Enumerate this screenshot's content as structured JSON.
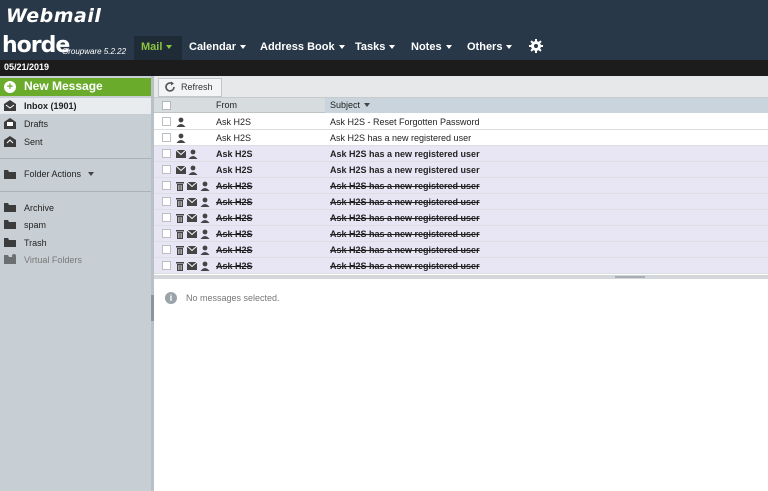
{
  "app": {
    "brand": "Webmail",
    "logo_word": "horde",
    "logo_sub": "Groupware 5.2.22",
    "date": "05/21/2019"
  },
  "menu": [
    {
      "label": "Mail",
      "active": true
    },
    {
      "label": "Calendar"
    },
    {
      "label": "Address Book"
    },
    {
      "label": "Tasks"
    },
    {
      "label": "Notes"
    },
    {
      "label": "Others"
    }
  ],
  "sidebar": {
    "new_message": "New Message",
    "folders": [
      {
        "label": "Inbox (1901)",
        "icon": "inbox-icon"
      },
      {
        "label": "Drafts",
        "icon": "drafts-icon"
      },
      {
        "label": "Sent",
        "icon": "sent-icon"
      }
    ],
    "folder_actions": "Folder Actions",
    "extra_folders": [
      {
        "label": "Archive",
        "icon": "folder-icon"
      },
      {
        "label": "spam",
        "icon": "folder-icon"
      },
      {
        "label": "Trash",
        "icon": "folder-icon"
      },
      {
        "label": "Virtual Folders",
        "icon": "virtual-folder-icon"
      }
    ]
  },
  "toolbar": {
    "refresh": "Refresh"
  },
  "list": {
    "columns": {
      "from": "From",
      "subject": "Subject"
    },
    "rows": [
      {
        "from": "Ask H2S",
        "subject": "Ask H2S - Reset Forgotten Password",
        "state": "read"
      },
      {
        "from": "Ask H2S",
        "subject": "Ask H2S has a new registered user",
        "state": "read"
      },
      {
        "from": "Ask H2S",
        "subject": "Ask H2S has a new registered user",
        "state": "unread"
      },
      {
        "from": "Ask H2S",
        "subject": "Ask H2S has a new registered user",
        "state": "unread"
      },
      {
        "from": "Ask H2S",
        "subject": "Ask H2S has a new registered user",
        "state": "deleted"
      },
      {
        "from": "Ask H2S",
        "subject": "Ask H2S has a new registered user",
        "state": "deleted"
      },
      {
        "from": "Ask H2S",
        "subject": "Ask H2S has a new registered user",
        "state": "deleted"
      },
      {
        "from": "Ask H2S",
        "subject": "Ask H2S has a new registered user",
        "state": "deleted"
      },
      {
        "from": "Ask H2S",
        "subject": "Ask H2S has a new registered user",
        "state": "deleted"
      },
      {
        "from": "Ask H2S",
        "subject": "Ask H2S has a new registered user",
        "state": "deleted"
      }
    ]
  },
  "preview": {
    "empty_text": "No messages selected."
  },
  "colors": {
    "header_bg": "#283848",
    "accent_green": "#6aab2c",
    "active_menu": "#8cc63f",
    "sidebar_bg": "#c8cfd4",
    "unread_row": "#e8e6f4"
  }
}
